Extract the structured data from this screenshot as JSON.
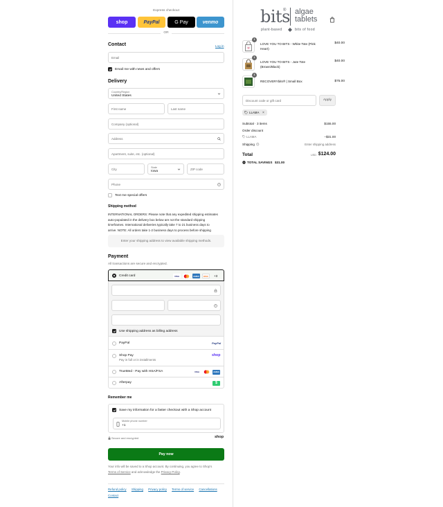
{
  "express": {
    "title": "Express checkout",
    "buttons": [
      {
        "label": "shop",
        "bg": "#5a31f4",
        "fg": "#ffffff"
      },
      {
        "label": "PayPal",
        "bg": "#ffc439",
        "fg": "#253b80"
      },
      {
        "label": "G Pay",
        "bg": "#000000",
        "fg": "#ffffff"
      },
      {
        "label": "venmo",
        "bg": "#3d95ce",
        "fg": "#ffffff"
      }
    ],
    "or_label": "OR"
  },
  "contact": {
    "heading": "Contact",
    "login_link": "Log in",
    "email_placeholder": "Email",
    "news_label": "Email me with news and offers"
  },
  "delivery": {
    "heading": "Delivery",
    "country_label": "Country/Region",
    "country_value": "United States",
    "first_name": "First name",
    "last_name": "Last name",
    "company": "Company (optional)",
    "address": "Address",
    "apartment": "Apartment, suite, etc. (optional)",
    "city": "City",
    "state_label": "State",
    "state_value": "Iowa",
    "zip": "ZIP code",
    "phone": "Phone",
    "text_offers": "Text me special offers"
  },
  "shipping_method": {
    "heading": "Shipping method",
    "notice": "INTERNATIONAL ORDERS: Please note that any expedited shipping estimates auto-populated in the delivery box below are not the standard shipping timeframes. International deliveries typically take 7 to 21 business days to arrive. NOTE: All orders take 1-2 business days to process before shipping",
    "notice_lines": [
      "INTERNATIONAL ORDERS: Please note that any expedited shipping estimates",
      "auto-populated in the delivery box below are not the standard shipping",
      "timeframes. International deliveries typically take 7 to 21 business days to",
      "arrive. NOTE: All orders take 1-2 business days to process before shipping"
    ],
    "empty_box": "Enter your shipping address to view available shipping methods."
  },
  "payment": {
    "heading": "Payment",
    "subtitle": "All transactions are secure and encrypted.",
    "credit_card_label": "Credit card",
    "card_logos": [
      "VISA",
      "MC",
      "AMEX",
      "DISC"
    ],
    "more_cards": "+3",
    "billing_label": "Use shipping address as billing address",
    "paypal_label": "PayPal",
    "paypal_logo": "PayPal",
    "shoppay_label": "Shop Pay",
    "shoppay_sub": "Pay in full or in installments",
    "shoppay_logo": "shop",
    "truemed_label": "TrueMed - Pay with HSA/FSA",
    "afterpay_label": "Afterpay",
    "afterpay_logo": "$"
  },
  "remember": {
    "heading": "Remember me",
    "save_label": "Save my information for a faster checkout with a Shop account",
    "mobile_label": "Mobile phone number",
    "mobile_value": "+1",
    "secure_label": "Secure and encrypted",
    "shop_logo": "shop"
  },
  "pay_now": "Pay now",
  "legal": {
    "line1": "Your info will be saved to a Shop account. By continuing, you agree to Shop's",
    "terms": "Terms of Service",
    "and": " and acknowledge the ",
    "privacy": "Privacy Policy",
    "end": "."
  },
  "footer": {
    "links": [
      "Refund policy",
      "Shipping",
      "Privacy policy",
      "Terms of service",
      "Cancellations"
    ],
    "contact": "Contact"
  },
  "brand": {
    "left_word": "bits",
    "left_tag": "plant-based",
    "right_word1": "algae",
    "right_word2": "tablets",
    "right_tag": "bits of food",
    "color": "#5b5f66"
  },
  "cart": {
    "items": [
      {
        "qty": "1",
        "name": "LOVE YOU TO BITS - White Tote (Pink Heart)",
        "name_lines": [
          "LOVE YOU TO BITS - White Tote (Pink",
          "Heart)"
        ],
        "price": "$40.00",
        "thumb_color": "#f2f2f2"
      },
      {
        "qty": "1",
        "name": "LOVE YOU TO BITS - Jute Tote (Brown/Black)",
        "name_lines": [
          "LOVE YOU TO BITS - Jute Tote",
          "(Brown/Black)"
        ],
        "price": "$40.00",
        "thumb_color": "#b58d4f"
      },
      {
        "qty": "1",
        "name": "RECOVERYbits® | Small Box",
        "name_lines": [
          "RECOVERYbits® | Small Box"
        ],
        "price": "$75.00",
        "thumb_color": "#2e5d2c"
      }
    ],
    "discount_placeholder": "Discount code or gift card",
    "apply_label": "Apply",
    "applied_code": "LLAMA",
    "subtotal_label": "Subtotal · 3 items",
    "subtotal_value": "$155.00",
    "order_discount_label": "Order discount",
    "order_discount_code": "LLAMA",
    "order_discount_value": "−$31.00",
    "shipping_label": "Shipping",
    "shipping_value": "Enter shipping address",
    "total_label": "Total",
    "currency": "USD",
    "total_value": "$124.00",
    "savings_label": "TOTAL SAVINGS",
    "savings_value": "$31.00"
  }
}
